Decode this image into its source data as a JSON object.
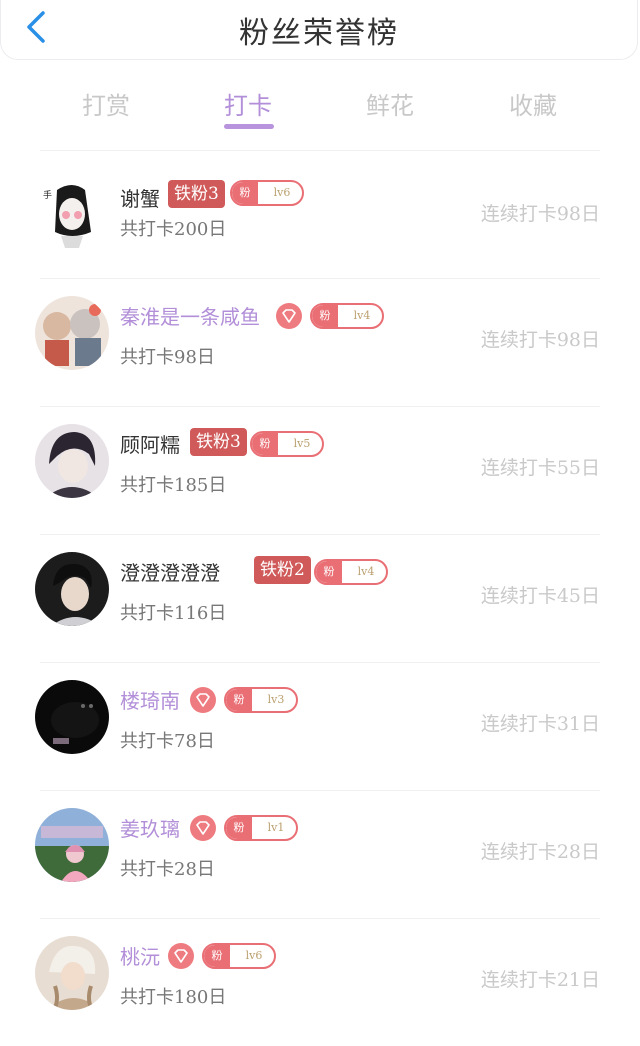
{
  "header": {
    "title": "粉丝荣誉榜",
    "back_icon": "chevron-left-icon"
  },
  "tabs": [
    {
      "label": "打赏",
      "active": false
    },
    {
      "label": "打卡",
      "active": true
    },
    {
      "label": "鲜花",
      "active": false
    },
    {
      "label": "收藏",
      "active": false
    }
  ],
  "colors": {
    "accent": "#b994de",
    "iron_badge": "#cf5a59",
    "level_badge": "#e96f75"
  },
  "fans": [
    {
      "name": "谢蟹",
      "name_style": "normal",
      "badge": "铁粉3",
      "fen": "粉",
      "level": "lv6",
      "total": "共打卡200日",
      "streak": "连续打卡98日"
    },
    {
      "name": "秦淮是一条咸鱼",
      "name_style": "purple",
      "badge": "diamond",
      "fen": "粉",
      "level": "lv4",
      "total": "共打卡98日",
      "streak": "连续打卡98日"
    },
    {
      "name": "顾阿糯",
      "name_style": "normal",
      "badge": "铁粉3",
      "fen": "粉",
      "level": "lv5",
      "total": "共打卡185日",
      "streak": "连续打卡55日"
    },
    {
      "name": "澄澄澄澄澄",
      "name_style": "normal",
      "badge": "铁粉2",
      "fen": "粉",
      "level": "lv4",
      "total": "共打卡116日",
      "streak": "连续打卡45日"
    },
    {
      "name": "楼琦南",
      "name_style": "purple",
      "badge": "diamond",
      "fen": "粉",
      "level": "lv3",
      "total": "共打卡78日",
      "streak": "连续打卡31日"
    },
    {
      "name": "姜玖璃",
      "name_style": "purple",
      "badge": "diamond",
      "fen": "粉",
      "level": "lv1",
      "total": "共打卡28日",
      "streak": "连续打卡28日"
    },
    {
      "name": "桃沅",
      "name_style": "purple",
      "badge": "diamond",
      "fen": "粉",
      "level": "lv6",
      "total": "共打卡180日",
      "streak": "连续打卡21日"
    }
  ]
}
